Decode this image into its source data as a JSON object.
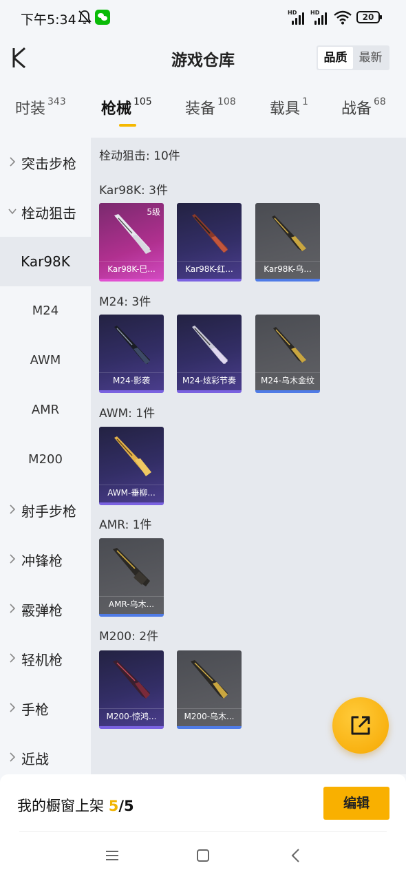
{
  "status_bar": {
    "time": "下午5:34",
    "battery": "20",
    "signal_label": "HD"
  },
  "header": {
    "title": "游戏仓库",
    "sort_options": [
      "品质",
      "最新"
    ],
    "active_sort": "品质"
  },
  "tabs": [
    {
      "label": "时装",
      "count": "343"
    },
    {
      "label": "枪械",
      "count": "105",
      "active": true
    },
    {
      "label": "装备",
      "count": "108"
    },
    {
      "label": "载具",
      "count": "1"
    },
    {
      "label": "战备",
      "count": "68"
    }
  ],
  "sidebar": {
    "items": [
      {
        "label": "突击步枪",
        "expanded": false
      },
      {
        "label": "栓动狙击",
        "expanded": true
      },
      {
        "label": "射手步枪",
        "expanded": false
      },
      {
        "label": "冲锋枪",
        "expanded": false
      },
      {
        "label": "霰弹枪",
        "expanded": false
      },
      {
        "label": "轻机枪",
        "expanded": false
      },
      {
        "label": "手枪",
        "expanded": false
      },
      {
        "label": "近战",
        "expanded": false
      }
    ],
    "sub_items": [
      "Kar98K",
      "M24",
      "AWM",
      "AMR",
      "M200"
    ],
    "active_sub": "Kar98K"
  },
  "content": {
    "summary": "栓动狙击: 10件",
    "groups": [
      {
        "title": "Kar98K: 3件",
        "cards": [
          {
            "name": "Kar98K-巳...",
            "rarity": "pink",
            "level": "5级"
          },
          {
            "name": "Kar98K-红...",
            "rarity": "purple"
          },
          {
            "name": "Kar98K-乌...",
            "rarity": "grey"
          }
        ]
      },
      {
        "title": "M24: 3件",
        "cards": [
          {
            "name": "M24-影袭",
            "rarity": "purple"
          },
          {
            "name": "M24-炫彩节奏",
            "rarity": "purple"
          },
          {
            "name": "M24-乌木金纹",
            "rarity": "grey"
          }
        ]
      },
      {
        "title": "AWM: 1件",
        "cards": [
          {
            "name": "AWM-垂柳...",
            "rarity": "purple"
          }
        ]
      },
      {
        "title": "AMR: 1件",
        "cards": [
          {
            "name": "AMR-乌木...",
            "rarity": "grey"
          }
        ]
      },
      {
        "title": "M200: 2件",
        "cards": [
          {
            "name": "M200-惊鸿...",
            "rarity": "purple"
          },
          {
            "name": "M200-乌木...",
            "rarity": "grey"
          }
        ]
      }
    ]
  },
  "bottom_bar": {
    "label": "我的橱窗上架",
    "shelf_current": "5",
    "shelf_total": "/5",
    "edit_label": "编辑"
  },
  "colors": {
    "accent": "#f9b000",
    "pink_rarity": "#e150d0",
    "purple_rarity": "#7a62e0",
    "grey_rarity": "#4f7be6"
  },
  "icons": {
    "back": "chevron-left-icon",
    "fab": "share-external-icon",
    "nav": [
      "menu-icon",
      "home-square-icon",
      "back-triangle-icon"
    ]
  }
}
